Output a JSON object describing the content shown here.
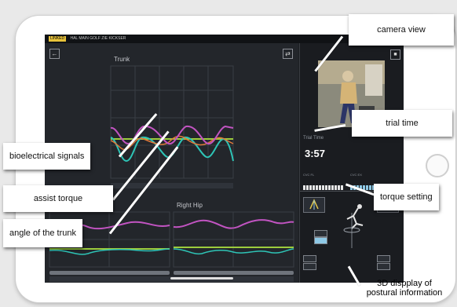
{
  "app": {
    "badge": "LINKED",
    "title": "HAL MAIN GOLF  ZIE   KICKSER"
  },
  "charts": {
    "trunk_title": "Trunk",
    "right_hip_title": "Right Hip"
  },
  "right_panel": {
    "trial_time_label": "Trial Time",
    "trial_time": "3:57",
    "cvc_left_label": "CVC FL",
    "cvc_right_label": "CVC EX"
  },
  "callouts": {
    "camera_view": "camera view",
    "trial_time": "trial time",
    "bioelectrical_signals": "bioelectrical signals",
    "assist_torque": "assist torque",
    "torque_setting": "torque setting",
    "angle_of_trunk": "angle of the trunk",
    "display_3d_line1": "3D dispplay of",
    "display_3d_line2": "postural information"
  },
  "colors": {
    "bioelectrical": "#2ec4b6",
    "assist_torque": "#c254c2",
    "angle": "#9ccc3d",
    "signal_orange": "#e07a3a",
    "accent_blue": "#8ec9e6"
  },
  "icons": {
    "back": "arrow-left-icon",
    "sync": "sync-arrows-icon",
    "camera_toggle": "camera-icon"
  }
}
